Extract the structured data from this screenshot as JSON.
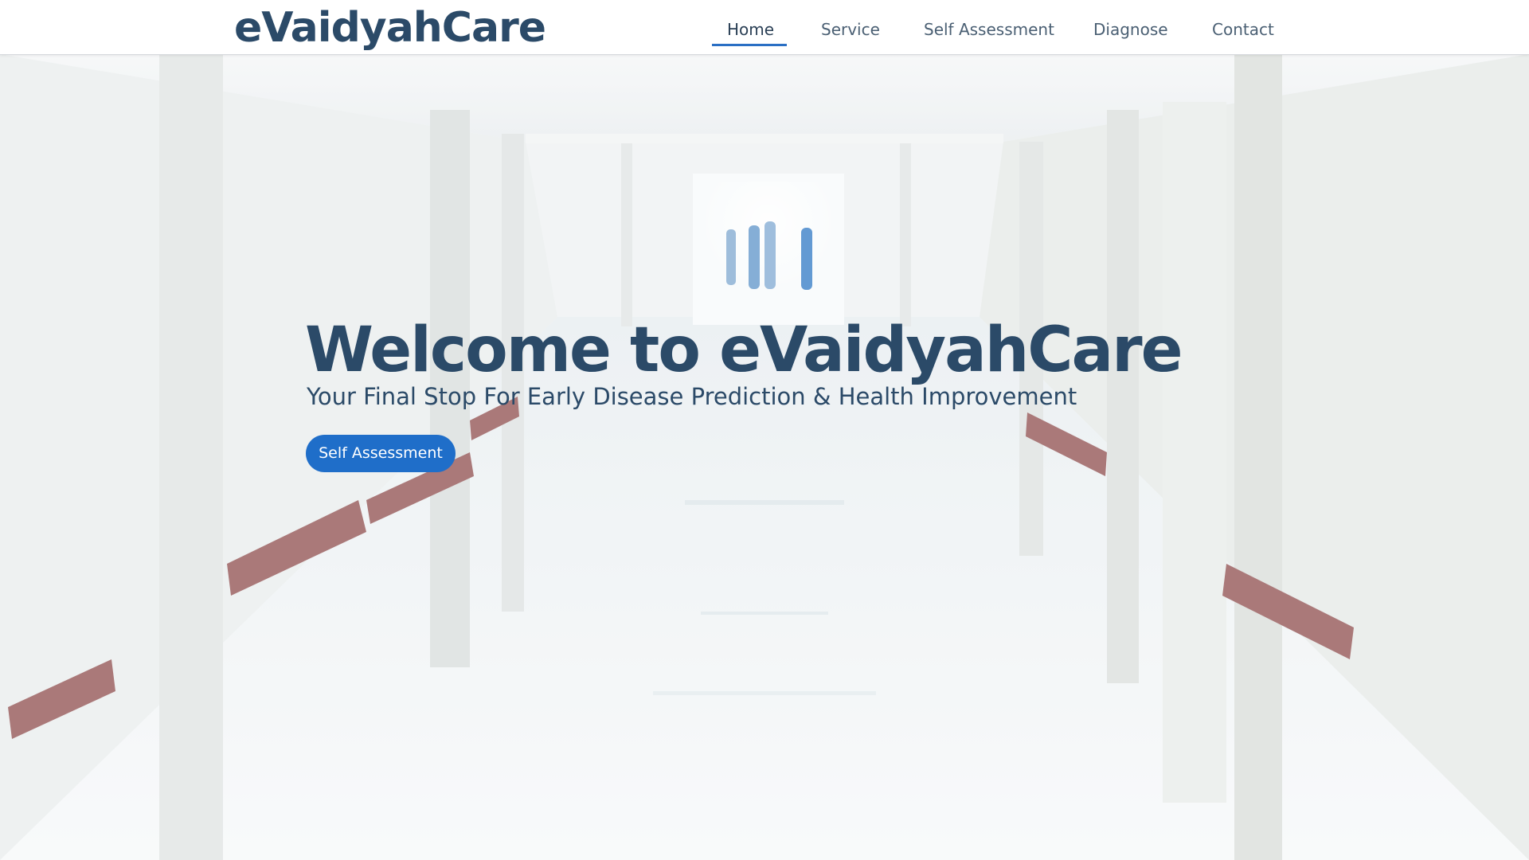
{
  "header": {
    "logo_text": "eVaidyahCare",
    "nav": [
      {
        "label": "Home",
        "active": true
      },
      {
        "label": "Service",
        "active": false
      },
      {
        "label": "Self Assessment",
        "active": false
      },
      {
        "label": "Diagnose",
        "active": false
      },
      {
        "label": "Contact",
        "active": false
      }
    ]
  },
  "hero": {
    "title": "Welcome to eVaidyahCare",
    "subtitle": "Your Final Stop For Early Disease Prediction & Health Improvement",
    "cta_label": "Self Assessment",
    "background": "hospital-corridor-image"
  },
  "colors": {
    "brand_text": "#2b4a68",
    "accent": "#1f6ec9",
    "nav_underline": "#2a6fc4"
  }
}
